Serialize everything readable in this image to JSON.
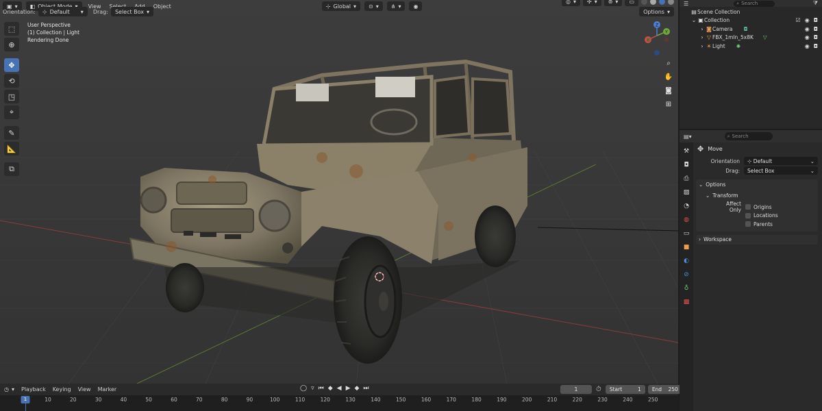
{
  "viewport": {
    "mode": "Object Mode",
    "menus": [
      "View",
      "Select",
      "Add",
      "Object"
    ],
    "transform_orientation": "Global",
    "orientation_label": "Orientation:",
    "orientation_value": "Default",
    "drag_label": "Drag:",
    "drag_value": "Select Box",
    "options_label": "Options",
    "overlay": {
      "line1": "User Perspective",
      "line2": "(1) Collection | Light",
      "line3": "Rendering Done"
    },
    "gizmo": {
      "z": "Z",
      "y": "Y",
      "x": "X"
    }
  },
  "timeline": {
    "menus": [
      "Playback",
      "Keying",
      "View",
      "Marker"
    ],
    "current_frame": "1",
    "start_label": "Start",
    "start_value": "1",
    "end_label": "End",
    "end_value": "250",
    "ticks": [
      "10",
      "20",
      "30",
      "40",
      "50",
      "60",
      "70",
      "80",
      "90",
      "100",
      "110",
      "120",
      "130",
      "140",
      "150",
      "160",
      "170",
      "180",
      "190",
      "200",
      "210",
      "220",
      "230",
      "240",
      "250"
    ],
    "playhead": "1"
  },
  "outliner": {
    "search_placeholder": "Search",
    "root": "Scene Collection",
    "collection": "Collection",
    "items": [
      {
        "name": "Camera"
      },
      {
        "name": "FBX_1mln_5x8K"
      },
      {
        "name": "Light"
      }
    ]
  },
  "properties": {
    "search_placeholder": "Search",
    "tool_title": "Move",
    "orientation_label": "Orientation",
    "orientation_value": "Default",
    "drag_label": "Drag:",
    "drag_value": "Select Box",
    "options_panel": "Options",
    "transform_panel": "Transform",
    "affect_only_label": "Affect Only",
    "checkboxes": [
      "Origins",
      "Locations",
      "Parents"
    ],
    "workspace_panel": "Workspace"
  },
  "colors": {
    "accent": "#4772b3",
    "axis_x": "#d44a4a",
    "axis_y": "#6fa83a",
    "axis_z": "#4a7fd4"
  }
}
